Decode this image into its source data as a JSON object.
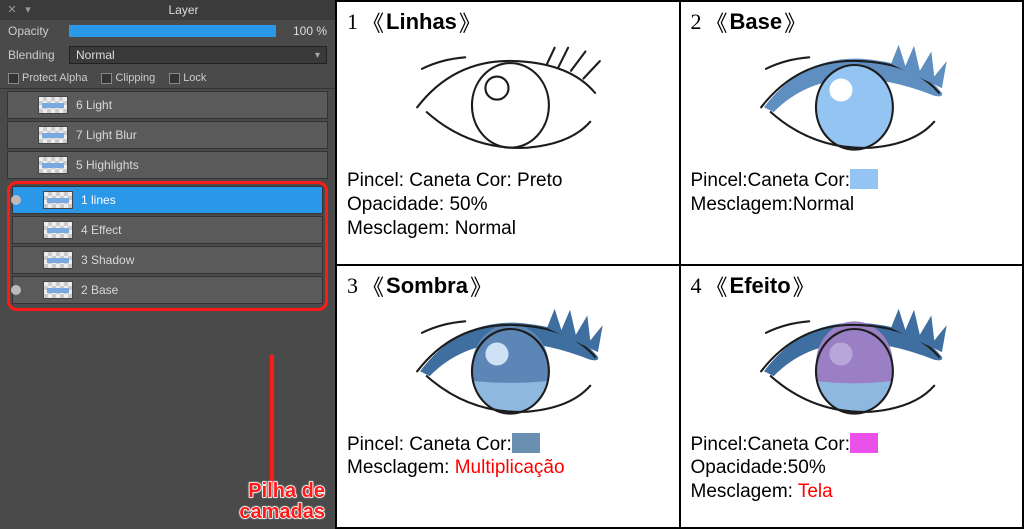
{
  "panel": {
    "title": "Layer",
    "opacity_label": "Opacity",
    "opacity_value": "100 %",
    "blending_label": "Blending",
    "blending_value": "Normal",
    "checks": {
      "protect_alpha": "Protect Alpha",
      "clipping": "Clipping",
      "lock": "Lock"
    },
    "layers_top": [
      {
        "name": "6 Light"
      },
      {
        "name": "7 Light Blur"
      },
      {
        "name": "5 Highlights"
      }
    ],
    "layers_group": [
      {
        "name": "1 lines",
        "selected": true,
        "vis": true
      },
      {
        "name": "4 Effect"
      },
      {
        "name": "3 Shadow"
      },
      {
        "name": "2 Base",
        "vis": true
      }
    ],
    "caption_line1": "Pilha de",
    "caption_line2": "camadas"
  },
  "cells": [
    {
      "num": "1",
      "title": "Linhas",
      "lines": [
        {
          "pre": "Pincel: Caneta  Cor: Preto"
        },
        {
          "pre": "Opacidade: 50%"
        },
        {
          "pre": "Mesclagem: Normal"
        }
      ]
    },
    {
      "num": "2",
      "title": "Base",
      "lines": [
        {
          "pre": "Pincel:Caneta Cor:",
          "swatch": "sw-blue"
        },
        {
          "pre": "Mesclagem:Normal"
        }
      ]
    },
    {
      "num": "3",
      "title": "Sombra",
      "lines": [
        {
          "pre": "Pincel: Caneta Cor:",
          "swatch": "sw-steel"
        },
        {
          "pre": "Mesclagem: ",
          "red": "Multiplicação"
        }
      ]
    },
    {
      "num": "4",
      "title": "Efeito",
      "lines": [
        {
          "pre": "Pincel:Caneta Cor:",
          "swatch": "sw-mag"
        },
        {
          "pre": "Opacidade:50%"
        },
        {
          "pre": "Mesclagem: ",
          "red": "Tela"
        }
      ]
    }
  ]
}
